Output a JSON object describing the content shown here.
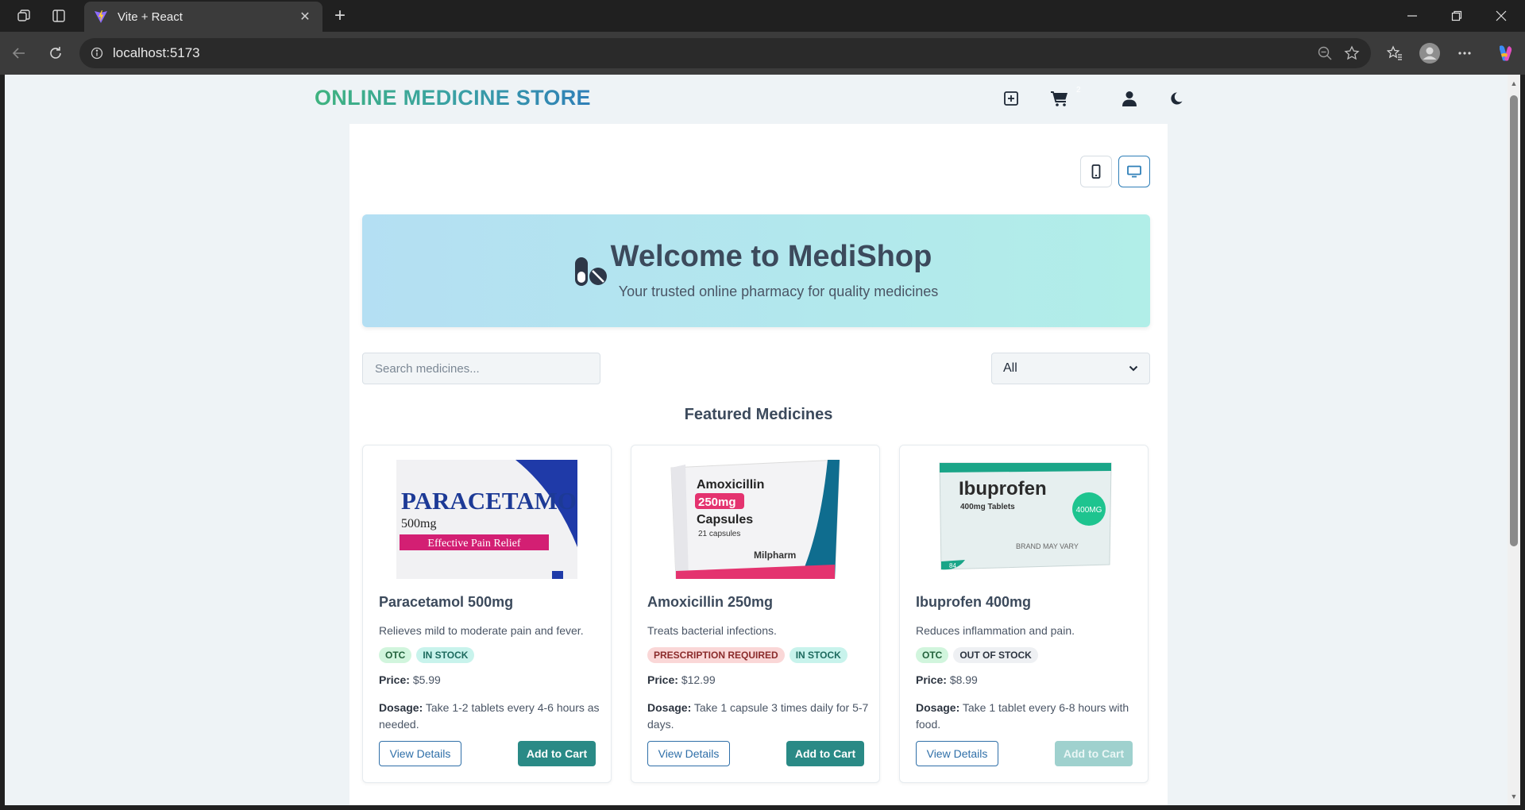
{
  "browser": {
    "tab_title": "Vite + React",
    "url": "localhost:5173"
  },
  "header": {
    "site_title": "ONLINE MEDICINE STORE",
    "cart_count": "2",
    "icons": [
      "add-medicine-icon",
      "cart-icon",
      "user-icon",
      "moon-icon"
    ]
  },
  "view_toggle": {
    "mobile": "mobile-icon",
    "desktop": "desktop-icon",
    "active": "desktop"
  },
  "hero": {
    "title": "Welcome to MediShop",
    "subtitle": "Your trusted online pharmacy for quality medicines"
  },
  "filters": {
    "search_placeholder": "Search medicines...",
    "category_selected": "All"
  },
  "section_title": "Featured Medicines",
  "products": [
    {
      "name": "Paracetamol 500mg",
      "description": "Relieves mild to moderate pain and fever.",
      "badge1": "OTC",
      "badge2": "IN STOCK",
      "price_label": "Price:",
      "price": "$5.99",
      "dosage_label": "Dosage:",
      "dosage": "Take 1-2 tablets every 4-6 hours as needed.",
      "details_label": "View Details",
      "cart_label": "Add to Cart",
      "pack_title": "PARACETAMOL",
      "pack_strength": "500mg",
      "pack_tagline": "Effective Pain Relief"
    },
    {
      "name": "Amoxicillin 250mg",
      "description": "Treats bacterial infections.",
      "badge1": "PRESCRIPTION REQUIRED",
      "badge2": "IN STOCK",
      "price_label": "Price:",
      "price": "$12.99",
      "dosage_label": "Dosage:",
      "dosage": "Take 1 capsule 3 times daily for 5-7 days.",
      "details_label": "View Details",
      "cart_label": "Add to Cart",
      "pack_title": "Amoxicillin",
      "pack_strength": "250mg",
      "pack_form": "Capsules",
      "pack_count": "21 capsules",
      "pack_maker": "Milpharm"
    },
    {
      "name": "Ibuprofen 400mg",
      "description": "Reduces inflammation and pain.",
      "badge1": "OTC",
      "badge2": "OUT OF STOCK",
      "price_label": "Price:",
      "price": "$8.99",
      "dosage_label": "Dosage:",
      "dosage": "Take 1 tablet every 6-8 hours with food.",
      "details_label": "View Details",
      "cart_label": "Add to Cart",
      "pack_title": "Ibuprofen",
      "pack_form": "400mg Tablets",
      "pack_seal": "400MG",
      "pack_note": "BRAND MAY VARY",
      "pack_count": "84"
    }
  ],
  "colors": {
    "brand_green": "#3fb37f",
    "brand_blue": "#2f7fb8",
    "cart_button": "#2a8a86",
    "cart_button_disabled": "#9fd1ce"
  }
}
